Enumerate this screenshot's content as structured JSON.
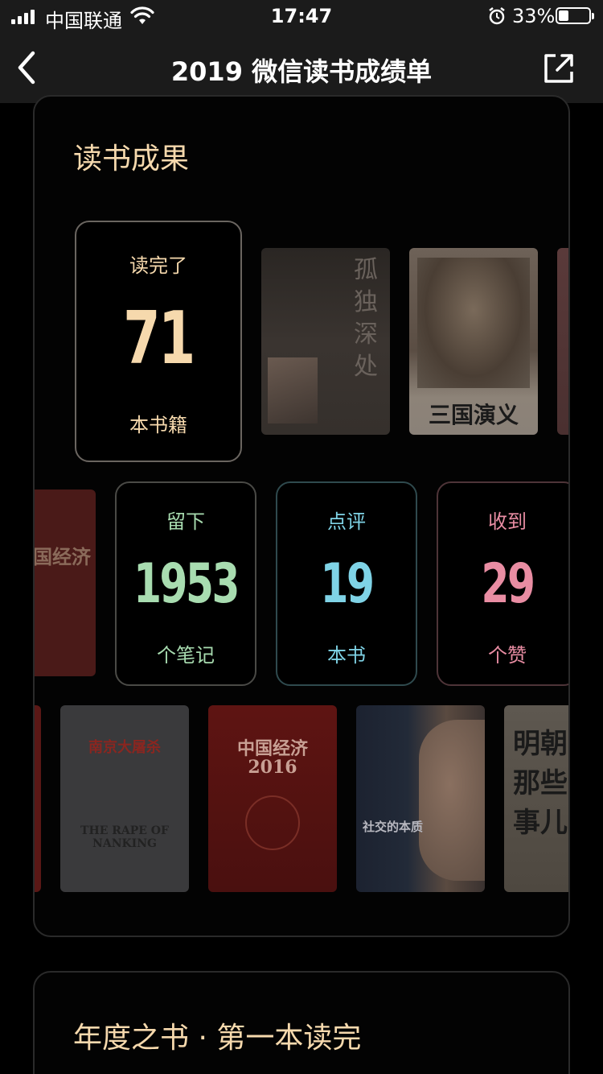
{
  "status_bar": {
    "carrier": "中国联通",
    "time": "17:47",
    "battery_percent": "33%",
    "battery_level": 0.33,
    "signal_bars": 4
  },
  "nav": {
    "title": "2019 微信读书成绩单",
    "back_icon": "chevron-left-icon",
    "share_icon": "share-icon"
  },
  "card": {
    "title": "读书成果",
    "stats": {
      "read": {
        "top": "读完了",
        "value": "71",
        "bottom": "本书籍",
        "color": "#f6d9ad"
      },
      "notes": {
        "top": "留下",
        "value": "1953",
        "bottom": "个笔记",
        "color": "#a8dcb0"
      },
      "reviews": {
        "top": "点评",
        "value": "19",
        "bottom": "本书",
        "color": "#7fd3e6"
      },
      "likes": {
        "top": "收到",
        "value": "29",
        "bottom": "个赞",
        "color": "#e98da3"
      }
    },
    "books": {
      "solitude": {
        "title": "孤独深处"
      },
      "sanguo": {
        "title": "三国演义"
      },
      "econ_left": {
        "title": "国经济"
      },
      "nanking": {
        "title": "南京大屠杀",
        "subtitle": "THE RAPE OF NANKING"
      },
      "china2016": {
        "title": "中国经济",
        "year": "2016"
      },
      "social": {
        "title": "社交的本质"
      },
      "ming": {
        "title": "明朝那些事儿"
      }
    }
  },
  "card2": {
    "title": "年度之书 · 第一本读完"
  }
}
